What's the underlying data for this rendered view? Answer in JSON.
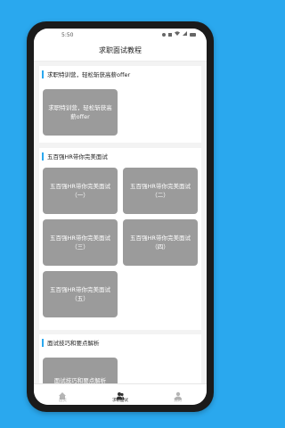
{
  "status_bar": {
    "time": "5:50"
  },
  "header": {
    "title": "求职面试教程"
  },
  "sections": [
    {
      "title": "求职特训营，轻松斩获高薪offer",
      "cards": [
        {
          "label": "求职特训营，轻松斩获高薪offer"
        }
      ]
    },
    {
      "title": "五百强HR带你完美面试",
      "cards": [
        {
          "label": "五百强HR带你完美面试（一）"
        },
        {
          "label": "五百强HR带你完美面试（二）"
        },
        {
          "label": "五百强HR带你完美面试（三）"
        },
        {
          "label": "五百强HR带你完美面试（四）"
        },
        {
          "label": "五百强HR带你完美面试（五）"
        }
      ]
    },
    {
      "title": "面试技巧和要点解析",
      "cards": [
        {
          "label": "面试技巧和要点解析"
        }
      ]
    }
  ],
  "tabbar": {
    "tabs": [
      {
        "label": "首页",
        "icon": "home-icon",
        "active": false
      },
      {
        "label": "求职面试",
        "icon": "people-icon",
        "active": true
      },
      {
        "label": "我的",
        "icon": "person-icon",
        "active": false
      }
    ]
  },
  "colors": {
    "background": "#2aa8ee",
    "accent": "#2aa8ee",
    "card": "#9b9b9b"
  }
}
